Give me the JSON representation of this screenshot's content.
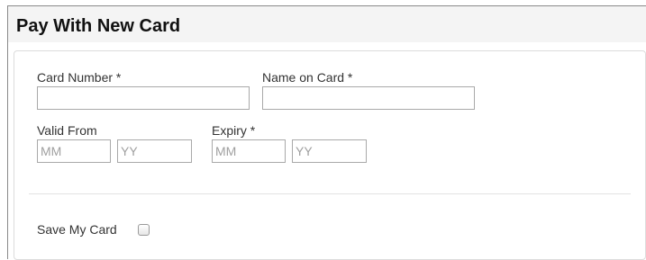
{
  "form": {
    "title": "Pay With New Card",
    "card_number": {
      "label": "Card Number *",
      "value": ""
    },
    "name_on_card": {
      "label": "Name on Card *",
      "value": ""
    },
    "valid_from": {
      "label": "Valid From",
      "month_placeholder": "MM",
      "year_placeholder": "YY"
    },
    "expiry": {
      "label": "Expiry *",
      "month_placeholder": "MM",
      "year_placeholder": "YY"
    },
    "save_card": {
      "label": "Save My Card",
      "checked": false
    }
  },
  "colors": {
    "header_background": "#f4f4f4",
    "input_border": "#a9a9a9",
    "placeholder_text": "#a0a0a0"
  }
}
